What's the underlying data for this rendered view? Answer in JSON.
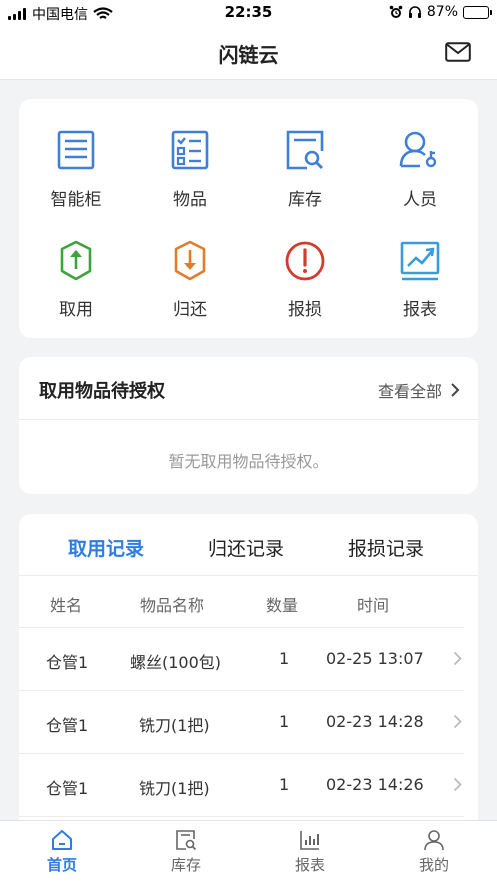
{
  "status_bar": {
    "carrier": "中国电信",
    "time": "22:35",
    "battery": "87%"
  },
  "header": {
    "title": "闪链云",
    "right_icon": "mail-icon"
  },
  "quick_menu": [
    {
      "label": "智能柜",
      "icon": "smart-cabinet-icon"
    },
    {
      "label": "物品",
      "icon": "items-icon"
    },
    {
      "label": "库存",
      "icon": "inventory-icon"
    },
    {
      "label": "人员",
      "icon": "personnel-icon"
    },
    {
      "label": "取用",
      "icon": "take-icon"
    },
    {
      "label": "归还",
      "icon": "return-icon"
    },
    {
      "label": "报损",
      "icon": "report-damage-icon"
    },
    {
      "label": "报表",
      "icon": "report-chart-icon"
    }
  ],
  "pending_auth": {
    "title": "取用物品待授权",
    "view_all": "查看全部",
    "empty_text": "暂无取用物品待授权。"
  },
  "records": {
    "tabs": [
      "取用记录",
      "归还记录",
      "报损记录"
    ],
    "active_tab": 0,
    "columns": [
      "姓名",
      "物品名称",
      "数量",
      "时间"
    ],
    "rows": [
      {
        "name": "仓管1",
        "item": "螺丝(100包)",
        "qty": "1",
        "time": "02-25 13:07"
      },
      {
        "name": "仓管1",
        "item": "铣刀(1把)",
        "qty": "1",
        "time": "02-23 14:28"
      },
      {
        "name": "仓管1",
        "item": "铣刀(1把)",
        "qty": "1",
        "time": "02-23 14:26"
      }
    ]
  },
  "tabbar": {
    "items": [
      {
        "label": "首页",
        "icon": "home-icon"
      },
      {
        "label": "库存",
        "icon": "inventory-tab-icon"
      },
      {
        "label": "报表",
        "icon": "chart-tab-icon"
      },
      {
        "label": "我的",
        "icon": "user-icon"
      }
    ],
    "active": 0
  },
  "colors": {
    "accent": "#2f7de1",
    "blue_icon": "#3f7fd6",
    "green_icon": "#3ba33b",
    "orange_icon": "#e27c2a",
    "red_icon": "#d53a2e",
    "cyan_icon": "#3a9bd9"
  }
}
